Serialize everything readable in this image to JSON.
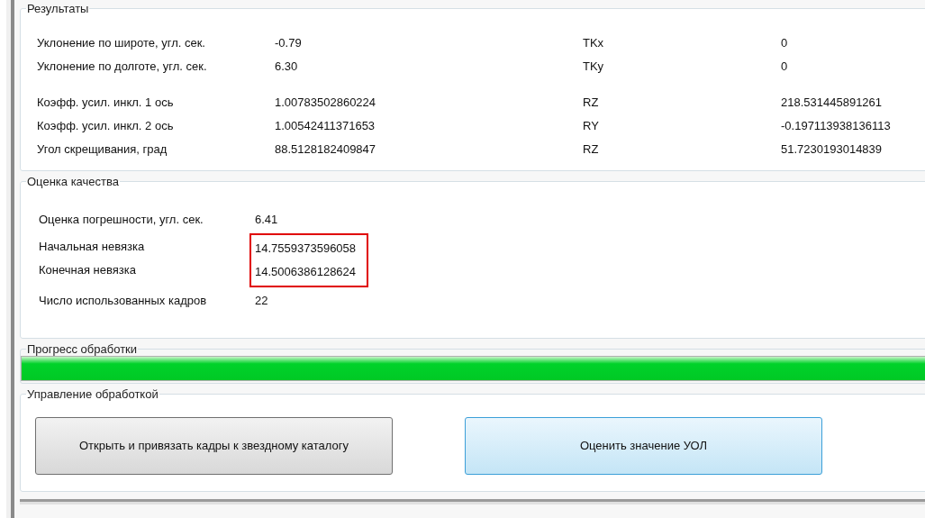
{
  "results": {
    "title": "Результаты",
    "groups": [
      [
        {
          "label": "Уклонение по широте, угл. сек.",
          "value": "-0.79",
          "label_2": "TKx",
          "value_2": "0"
        },
        {
          "label": "Уклонение по долготе, угл. сек.",
          "value": "6.30",
          "label_2": "TKy",
          "value_2": "0"
        }
      ],
      [
        {
          "label": "Коэфф. усил. инкл. 1 ось",
          "value": "1.00783502860224",
          "label_2": "RZ",
          "value_2": "218.531445891261"
        },
        {
          "label": "Коэфф. усил. инкл. 2 ось",
          "value": "1.00542411371653",
          "label_2": "RY",
          "value_2": "-0.197113938136113"
        },
        {
          "label": "Угол скрещивания, град",
          "value": "88.5128182409847",
          "label_2": "RZ",
          "value_2": "51.7230193014839"
        }
      ]
    ]
  },
  "quality": {
    "title": "Оценка качества",
    "sections": [
      {
        "highlighted": false,
        "rows": [
          {
            "label": "Оценка погрешности, угл. сек.",
            "value": "6.41"
          }
        ]
      },
      {
        "highlighted": true,
        "rows": [
          {
            "label": "Начальная невязка",
            "value": "14.7559373596058"
          },
          {
            "label": "Конечная невязка",
            "value": "14.5006386128624"
          }
        ]
      },
      {
        "highlighted": false,
        "rows": [
          {
            "label": "Число использованных кадров",
            "value": "22"
          }
        ]
      }
    ]
  },
  "progress": {
    "title": "Прогресс обработки",
    "level": 1.0
  },
  "control": {
    "title": "Управление обработкой",
    "buttons": [
      {
        "label": "Открыть и привязать кадры к звездному каталогу",
        "hovered": false
      },
      {
        "label": "Оценить значение УОЛ",
        "hovered": true
      }
    ]
  }
}
